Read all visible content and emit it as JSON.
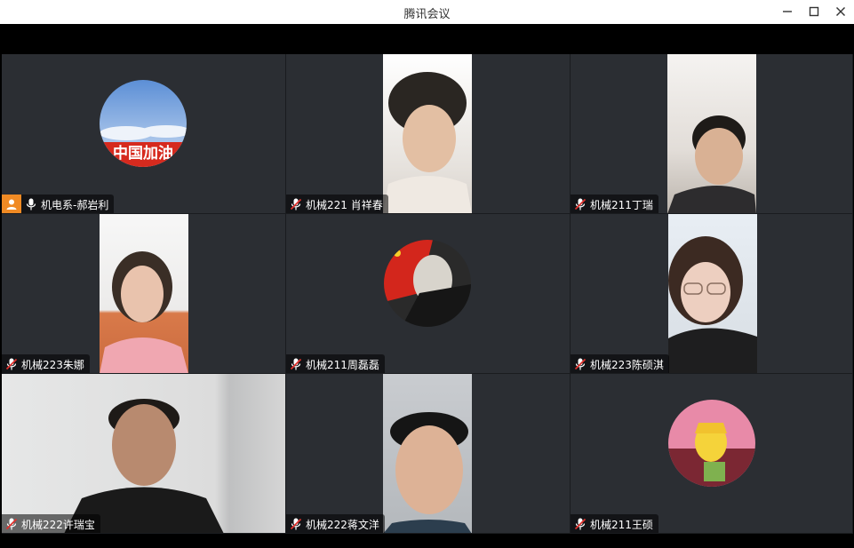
{
  "window": {
    "title": "腾讯会议"
  },
  "participants": [
    {
      "name": "机电系-郝岩利"
    },
    {
      "name": "机械221 肖祥春"
    },
    {
      "name": "机械211丁瑞"
    },
    {
      "name": "机械223朱娜"
    },
    {
      "name": "机械211周磊磊"
    },
    {
      "name": "机械223陈硕淇"
    },
    {
      "name": "机械222许瑞宝"
    },
    {
      "name": "机械222蒋文洋"
    },
    {
      "name": "机械211王硕"
    }
  ],
  "avatar_text": {
    "p0": "中国加油"
  },
  "icons": {
    "mic_muted": "mic-muted-icon",
    "mic_on": "mic-icon",
    "host": "host-person-icon"
  },
  "colors": {
    "tile_bg": "#2b2e33",
    "host_badge": "#f08a24",
    "titlebar": "#ffffff"
  }
}
